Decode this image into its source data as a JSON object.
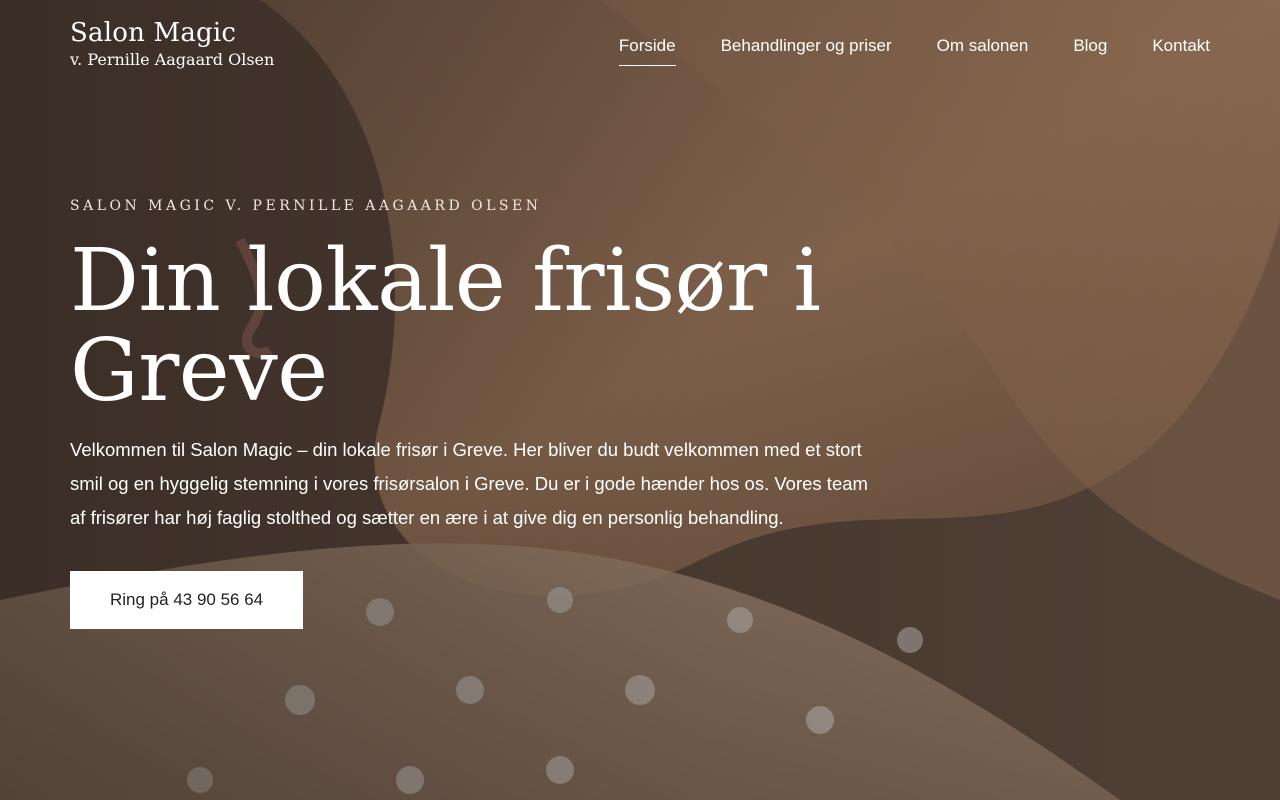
{
  "header": {
    "logo_title": "Salon Magic",
    "logo_subtitle": "v. Pernille Aagaard Olsen"
  },
  "nav": {
    "items": [
      {
        "label": "Forside",
        "active": true
      },
      {
        "label": "Behandlinger og priser",
        "active": false
      },
      {
        "label": "Om salonen",
        "active": false
      },
      {
        "label": "Blog",
        "active": false
      },
      {
        "label": "Kontakt",
        "active": false
      }
    ]
  },
  "hero": {
    "eyebrow": "Salon Magic v. Pernille Aagaard Olsen",
    "title": "Din lokale frisør i Greve",
    "intro": "Velkommen til Salon Magic – din lokale frisør i Greve. Her bliver du budt velkommen med et stort smil og en hyggelig stemning i vores frisørsalon i Greve. Du er i gode hænder hos os. Vores team af frisører har høj faglig stolthed og sætter en ære i at give dig en personlig behandling.",
    "cta_label": "Ring på 43 90 56 64"
  },
  "colors": {
    "text": "#ffffff",
    "button_bg": "#ffffff",
    "button_text": "#222222"
  }
}
